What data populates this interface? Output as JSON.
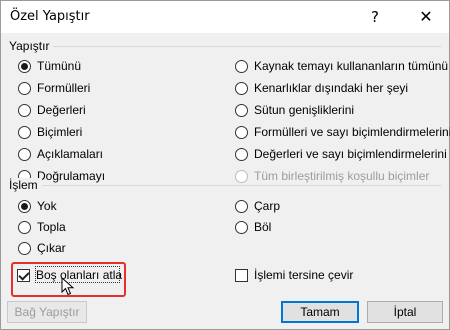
{
  "window": {
    "title": "Özel Yapıştır",
    "help_label": "?",
    "close_label": "✕"
  },
  "paste_group": {
    "label": "Yapıştır",
    "left_options": [
      {
        "label": "Tümünü",
        "checked": true
      },
      {
        "label": "Formülleri",
        "checked": false
      },
      {
        "label": "Değerleri",
        "checked": false
      },
      {
        "label": "Biçimleri",
        "checked": false
      },
      {
        "label": "Açıklamaları",
        "checked": false
      },
      {
        "label": "Doğrulamayı",
        "checked": false
      }
    ],
    "right_options": [
      {
        "label": "Kaynak temayı kullananların tümünü",
        "checked": false
      },
      {
        "label": "Kenarlıklar dışındaki her şeyi",
        "checked": false
      },
      {
        "label": "Sütun genişliklerini",
        "checked": false
      },
      {
        "label": "Formülleri ve sayı biçimlendirmelerini",
        "checked": false
      },
      {
        "label": "Değerleri ve sayı biçimlendirmelerini",
        "checked": false
      },
      {
        "label": "Tüm birleştirilmiş koşullu biçimler",
        "checked": false,
        "disabled": true
      }
    ]
  },
  "operation_group": {
    "label": "İşlem",
    "left_options": [
      {
        "label": "Yok",
        "checked": true
      },
      {
        "label": "Topla",
        "checked": false
      },
      {
        "label": "Çıkar",
        "checked": false
      }
    ],
    "right_options": [
      {
        "label": "Çarp",
        "checked": false
      },
      {
        "label": "Böl",
        "checked": false
      }
    ]
  },
  "checkboxes": {
    "skip_blanks": {
      "label": "Boş olanları atla",
      "checked": true
    },
    "transpose": {
      "label": "İşlemi tersine çevir",
      "checked": false
    }
  },
  "buttons": {
    "paste_link": "Bağ Yapıştır",
    "ok": "Tamam",
    "cancel": "İptal"
  },
  "colors": {
    "highlight": "#e4322b",
    "primary_border": "#0078d7"
  }
}
